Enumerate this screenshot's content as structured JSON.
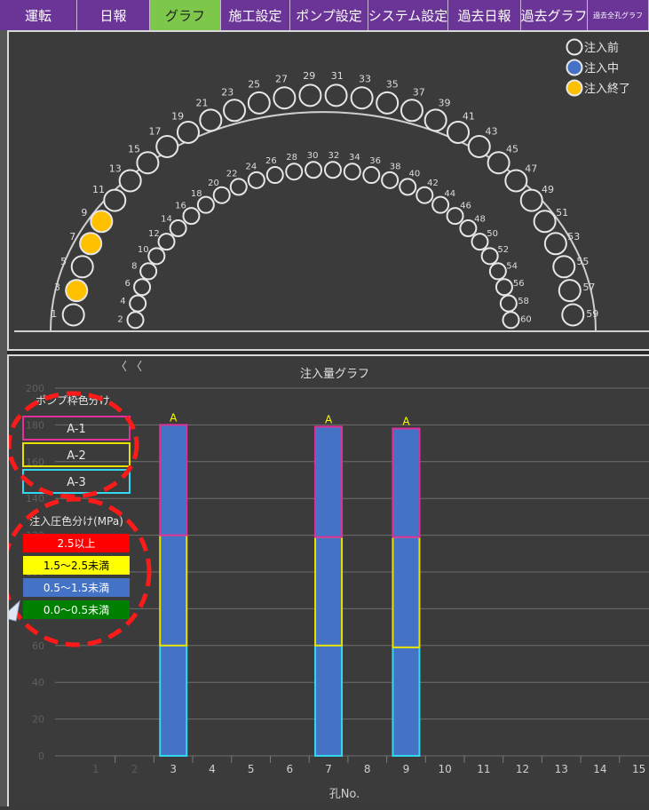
{
  "tabs": [
    {
      "label": "運転",
      "active": false
    },
    {
      "label": "日報",
      "active": false
    },
    {
      "label": "グラフ",
      "active": true
    },
    {
      "label": "施工設定",
      "active": false
    },
    {
      "label": "ポンプ設定",
      "active": false
    },
    {
      "label": "システム設定",
      "active": false
    },
    {
      "label": "過去日報",
      "active": false
    },
    {
      "label": "過去グラフ",
      "active": false
    },
    {
      "label": "過去全孔グラフ",
      "active": false
    }
  ],
  "hole_legend": [
    {
      "label": "注入前",
      "state": "before"
    },
    {
      "label": "注入中",
      "state": "during"
    },
    {
      "label": "注入終了",
      "state": "done"
    }
  ],
  "state_colors": {
    "before": "#3b3b3b",
    "during": "#4472c4",
    "done": "#ffc000"
  },
  "outer_holes": [
    1,
    3,
    5,
    7,
    9,
    11,
    13,
    15,
    17,
    19,
    21,
    23,
    25,
    27,
    29,
    31,
    33,
    35,
    37,
    39,
    41,
    43,
    45,
    47,
    49,
    51,
    53,
    55,
    57,
    59
  ],
  "inner_holes": [
    2,
    4,
    6,
    8,
    10,
    12,
    14,
    16,
    18,
    20,
    22,
    24,
    26,
    28,
    30,
    32,
    34,
    36,
    38,
    40,
    42,
    44,
    46,
    48,
    50,
    52,
    54,
    56,
    58,
    60
  ],
  "done_holes": [
    3,
    7,
    9
  ],
  "during_holes": [],
  "graph": {
    "nav": "〈 〈",
    "title": "注入量グラフ",
    "xlabel": "孔No."
  },
  "pump_legend": {
    "title": "ポンプ枠色分け",
    "items": [
      {
        "label": "A-1",
        "color": "#e0309a"
      },
      {
        "label": "A-2",
        "color": "#e8e000"
      },
      {
        "label": "A-3",
        "color": "#33d8f0"
      }
    ]
  },
  "pressure_legend": {
    "title": "注入圧色分け(MPa)",
    "items": [
      {
        "label": "2.5以上",
        "bg": "#ff0000",
        "fg": "#ffffff"
      },
      {
        "label": "1.5〜2.5未満",
        "bg": "#ffff00",
        "fg": "#000000"
      },
      {
        "label": "0.5〜1.5未満",
        "bg": "#4472c4",
        "fg": "#ffffff"
      },
      {
        "label": "0.0〜0.5未満",
        "bg": "#008000",
        "fg": "#ffffff"
      }
    ]
  },
  "chart_data": {
    "type": "bar",
    "title": "注入量グラフ",
    "xlabel": "孔No.",
    "ylabel": "",
    "categories": [
      "1",
      "2",
      "3",
      "4",
      "5",
      "6",
      "7",
      "8",
      "9",
      "10",
      "11",
      "12",
      "13",
      "14",
      "15"
    ],
    "ylim": [
      0,
      200
    ],
    "yticks": [
      0,
      20,
      40,
      60,
      80,
      100,
      120,
      140,
      160,
      180,
      200
    ],
    "grid": true,
    "bars": [
      {
        "hole": "3",
        "label": "A",
        "segments": [
          {
            "value": 60,
            "pump": "A-3",
            "pressure": "0.5〜1.5未満"
          },
          {
            "value": 60,
            "pump": "A-2",
            "pressure": "0.5〜1.5未満"
          },
          {
            "value": 60,
            "pump": "A-1",
            "pressure": "0.5〜1.5未満"
          }
        ]
      },
      {
        "hole": "7",
        "label": "A",
        "segments": [
          {
            "value": 60,
            "pump": "A-3",
            "pressure": "0.5〜1.5未満"
          },
          {
            "value": 59,
            "pump": "A-2",
            "pressure": "0.5〜1.5未満"
          },
          {
            "value": 60,
            "pump": "A-1",
            "pressure": "0.5〜1.5未満"
          }
        ]
      },
      {
        "hole": "9",
        "label": "A",
        "segments": [
          {
            "value": 59,
            "pump": "A-3",
            "pressure": "0.5〜1.5未満"
          },
          {
            "value": 60,
            "pump": "A-2",
            "pressure": "0.5〜1.5未満"
          },
          {
            "value": 59,
            "pump": "A-1",
            "pressure": "0.5〜1.5未満"
          }
        ]
      }
    ]
  }
}
